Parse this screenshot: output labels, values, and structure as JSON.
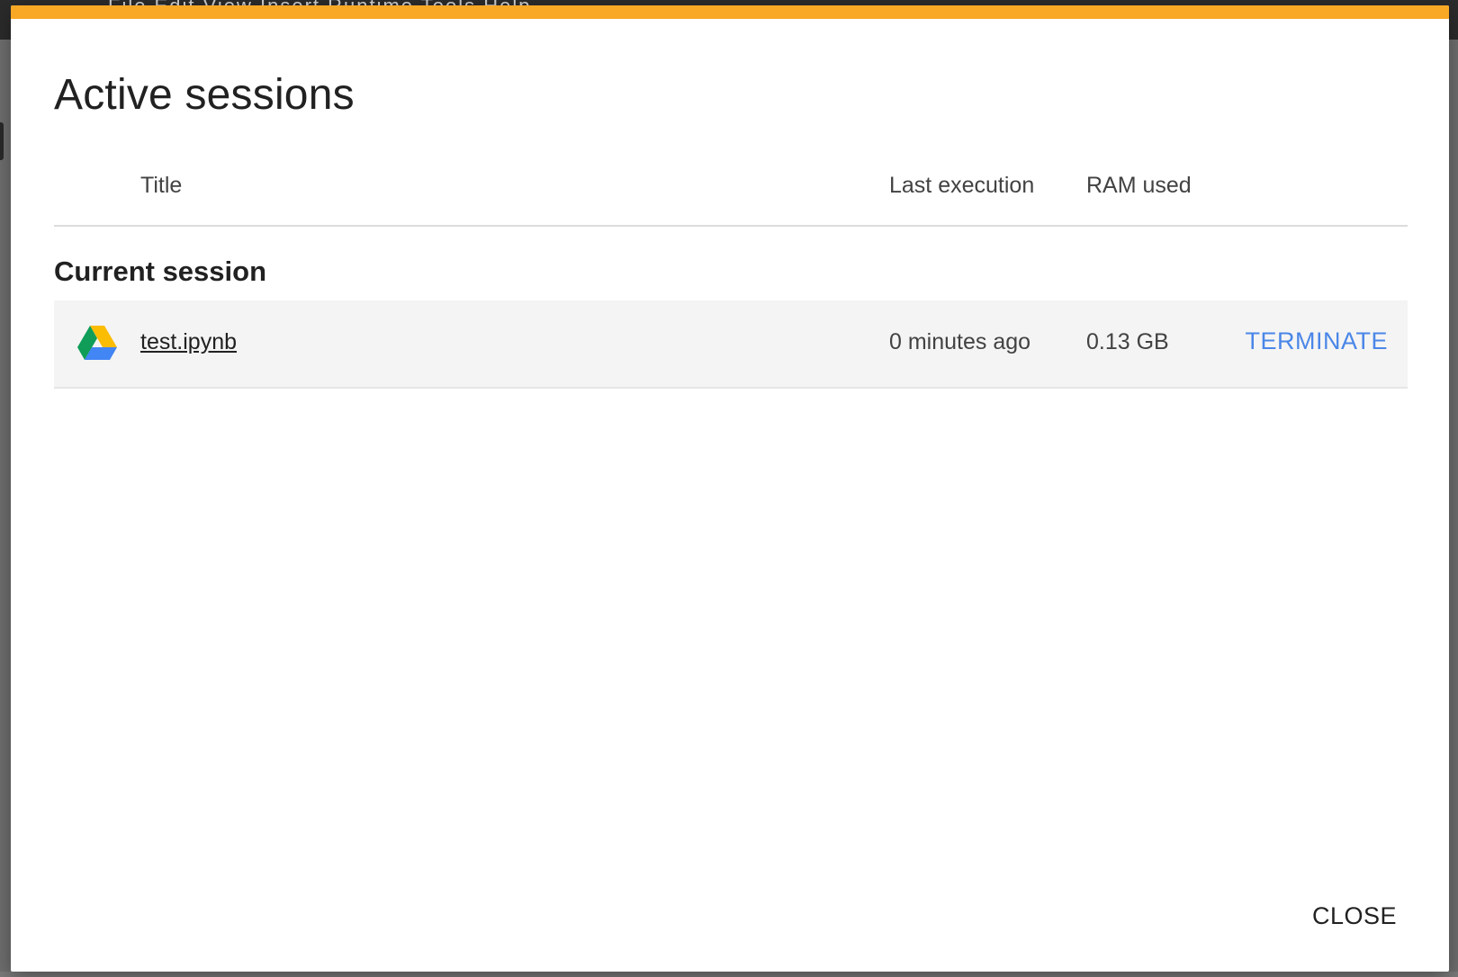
{
  "background": {
    "menubar_text": "File   Edit   View   Insert   Runtime   Tools   Help"
  },
  "colors": {
    "accent": "#f9a825",
    "link_blue": "#4a86e8",
    "row_background": "#f4f4f4"
  },
  "dialog": {
    "title": "Active sessions",
    "columns": {
      "title": "Title",
      "last_execution": "Last execution",
      "ram_used": "RAM used"
    },
    "section_heading": "Current session",
    "sessions": [
      {
        "icon": "google-drive-icon",
        "title": "test.ipynb",
        "last_execution": "0 minutes ago",
        "ram_used": "0.13 GB",
        "action_label": "TERMINATE"
      }
    ],
    "close_label": "CLOSE"
  }
}
